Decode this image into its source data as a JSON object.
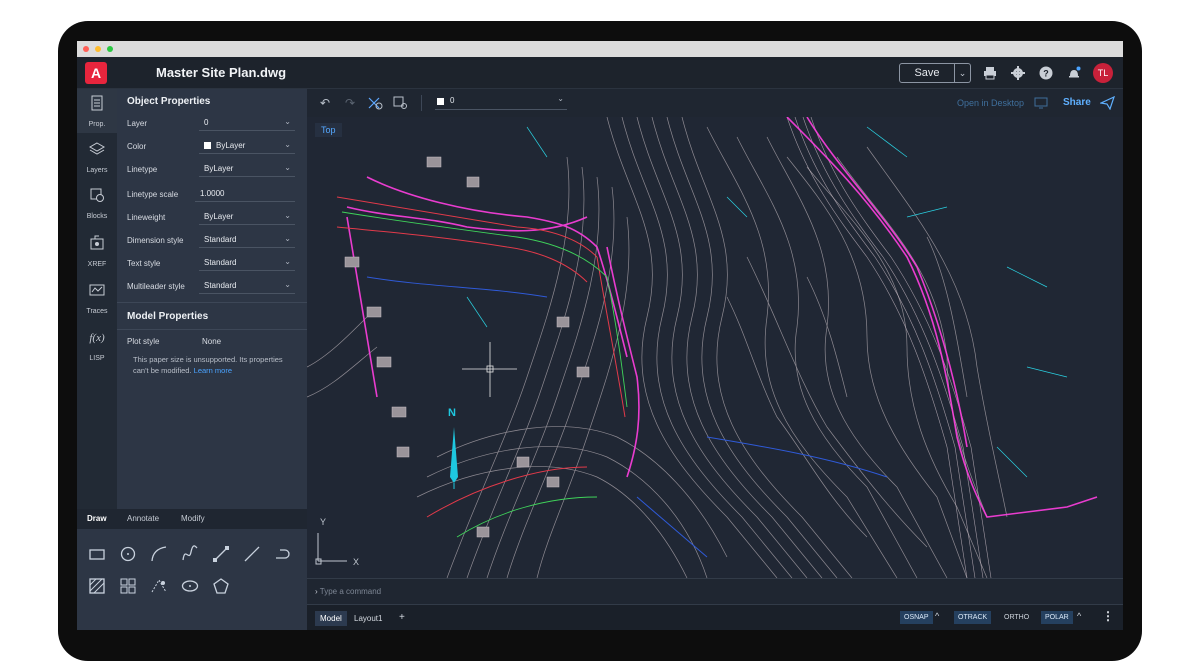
{
  "app": {
    "file_title": "Master Site Plan.dwg",
    "logo_letter": "A",
    "save_label": "Save",
    "avatar_initials": "TL"
  },
  "rail": [
    {
      "label": "Prop.",
      "icon": "properties-icon"
    },
    {
      "label": "Layers",
      "icon": "layers-icon"
    },
    {
      "label": "Blocks",
      "icon": "blocks-icon"
    },
    {
      "label": "XREF",
      "icon": "xref-icon"
    },
    {
      "label": "Traces",
      "icon": "traces-icon"
    },
    {
      "label": "LISP",
      "icon": "lisp-icon"
    }
  ],
  "object_properties": {
    "title": "Object Properties",
    "rows": [
      {
        "key": "Layer",
        "value": "0"
      },
      {
        "key": "Color",
        "value": "ByLayer"
      },
      {
        "key": "Linetype",
        "value": "ByLayer"
      },
      {
        "key": "Linetype scale",
        "value": "1.0000"
      },
      {
        "key": "Lineweight",
        "value": "ByLayer"
      },
      {
        "key": "Dimension style",
        "value": "Standard"
      },
      {
        "key": "Text style",
        "value": "Standard"
      },
      {
        "key": "Multileader style",
        "value": "Standard"
      }
    ]
  },
  "model_properties": {
    "title": "Model Properties",
    "plot_style_key": "Plot style",
    "plot_style_value": "None",
    "note": "This paper size is unsupported. Its properties can't be modified.",
    "note_link": "Learn more"
  },
  "draw_tabs": [
    "Draw",
    "Annotate",
    "Modify"
  ],
  "canvas_toolbar": {
    "layer_value": "0",
    "open_in_desktop": "Open in Desktop",
    "share": "Share"
  },
  "view_label": "Top",
  "north_label": "N",
  "ucs": {
    "y": "Y",
    "x": "X"
  },
  "command_placeholder": "Type a command",
  "status": {
    "tabs": [
      "Model",
      "Layout1"
    ],
    "add": "+",
    "toggles": [
      "OSNAP",
      "OTRACK",
      "ORTHO",
      "POLAR"
    ]
  },
  "colors": {
    "accent": "#e8253d",
    "link": "#4aa3ff",
    "contours": "#a9a3a8",
    "markup": "#ff3fe0",
    "background": "#202734"
  }
}
